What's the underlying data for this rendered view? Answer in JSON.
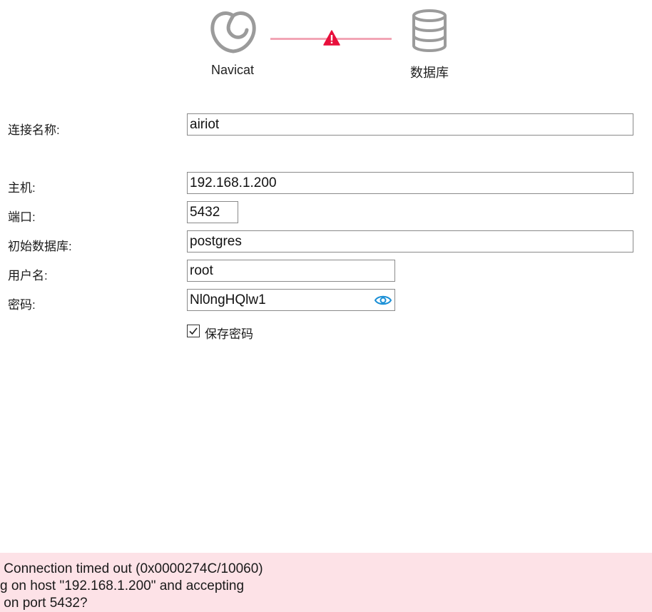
{
  "header": {
    "left_label": "Navicat",
    "right_label": "数据库",
    "status": "warning",
    "colors": {
      "line": "#f2a5b5",
      "warning": "#e8103c",
      "icon": "#9b9b9b"
    }
  },
  "form": {
    "connection_name": {
      "label": "连接名称:",
      "value": "airiot"
    },
    "host": {
      "label": "主机:",
      "value": "192.168.1.200"
    },
    "port": {
      "label": "端口:",
      "value": "5432"
    },
    "initial_database": {
      "label": "初始数据库:",
      "value": "postgres"
    },
    "username": {
      "label": "用户名:",
      "value": "root"
    },
    "password": {
      "label": "密码:",
      "value": "Nl0ngHQlw1"
    },
    "save_password": {
      "label": "保存密码",
      "checked": true
    }
  },
  "error": {
    "lines": [
      " Connection timed out (0x0000274C/10060)",
      "g on host \"192.168.1.200\" and accepting",
      " on port 5432?"
    ],
    "background": "#fde2e7"
  }
}
